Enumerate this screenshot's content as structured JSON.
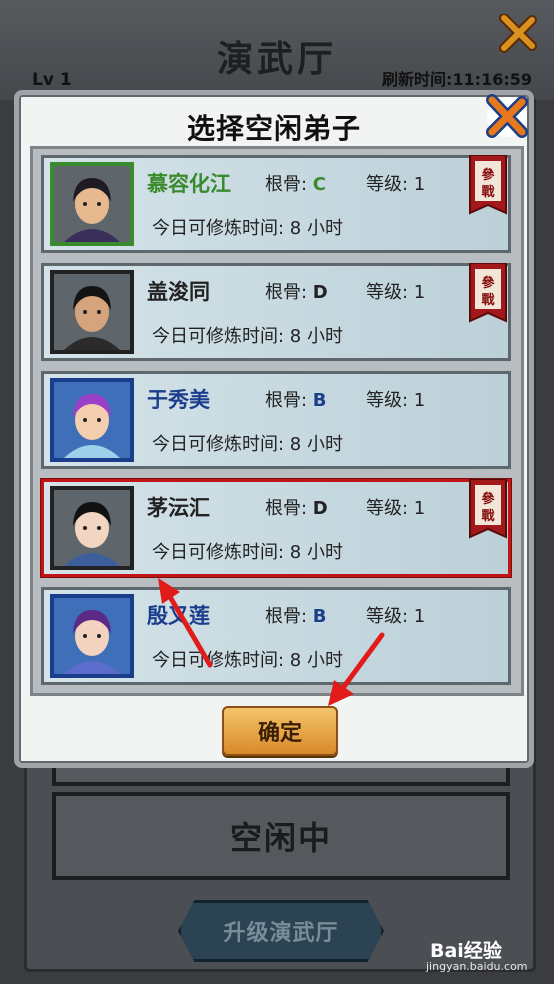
{
  "background": {
    "hall_title": "演武厅",
    "level": "Lv 1",
    "refresh": "刷新时间:11:16:59",
    "slot_status": "空闲中",
    "upgrade_label": "升级演武厅"
  },
  "dialog": {
    "title": "选择空闲弟子",
    "confirm_label": "确定"
  },
  "labels": {
    "bone": "根骨:",
    "level": "等级:",
    "train": "今日可修炼时间:",
    "war_badge": "參戰"
  },
  "disciples": [
    {
      "name": "慕容化江",
      "name_color": "#3a8a2e",
      "bone": "C",
      "bone_color": "#3a8a2e",
      "level": "1",
      "hours": "8 小时",
      "in_battle": true,
      "frame": "green"
    },
    {
      "name": "盖浚同",
      "name_color": "#222222",
      "bone": "D",
      "bone_color": "#222222",
      "level": "1",
      "hours": "8 小时",
      "in_battle": true,
      "frame": "black"
    },
    {
      "name": "于秀美",
      "name_color": "#1a3d8c",
      "bone": "B",
      "bone_color": "#1a3d8c",
      "level": "1",
      "hours": "8 小时",
      "in_battle": false,
      "frame": "blue"
    },
    {
      "name": "茅沄汇",
      "name_color": "#222222",
      "bone": "D",
      "bone_color": "#222222",
      "level": "1",
      "hours": "8 小时",
      "in_battle": true,
      "frame": "black",
      "selected": true
    },
    {
      "name": "殷又莲",
      "name_color": "#1a3d8c",
      "bone": "B",
      "bone_color": "#1a3d8c",
      "level": "1",
      "hours": "8 小时",
      "in_battle": false,
      "frame": "blue"
    }
  ],
  "watermark": {
    "brand": "Bai经验",
    "url": "jingyan.baidu.com"
  },
  "colors": {
    "accent_red": "#c11414",
    "confirm_orange": "#e6a345"
  }
}
